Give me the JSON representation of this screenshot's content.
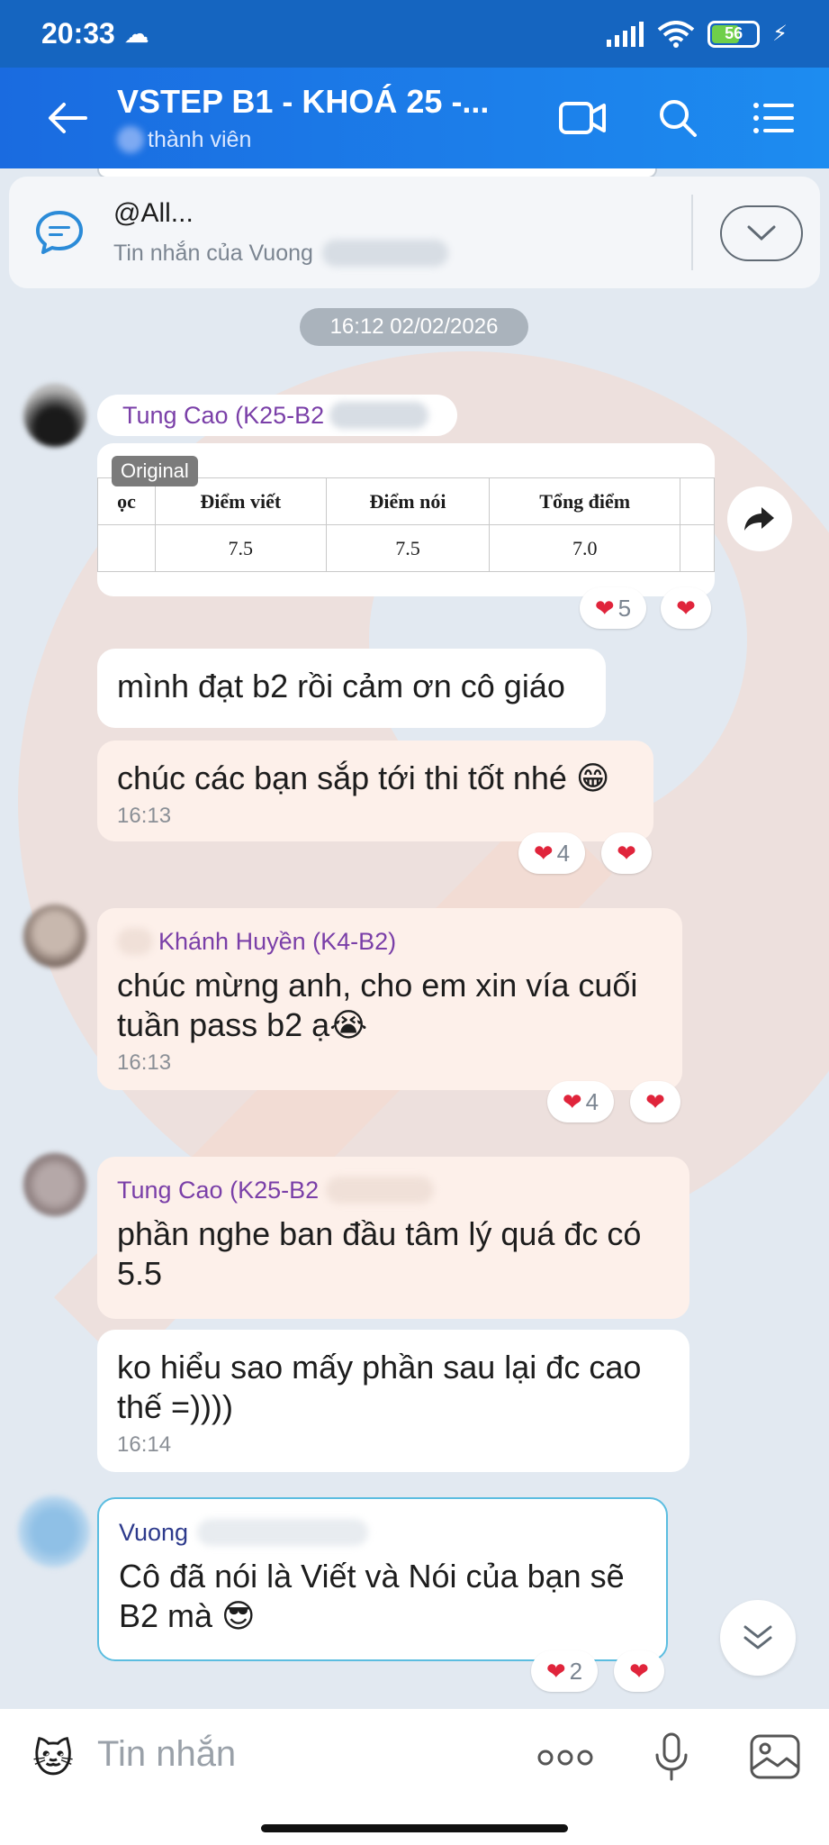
{
  "status_bar": {
    "time": "20:33",
    "battery": "56"
  },
  "header": {
    "title": "VSTEP B1 - KHOÁ 25 -...",
    "subtitle": "thành viên"
  },
  "pinned": {
    "title": "@All...",
    "subtitle": "Tin nhắn của Vuong"
  },
  "date_divider": "16:12 02/02/2026",
  "scorecard": {
    "badge": "Original",
    "headers": [
      "ọc",
      "Điểm viết",
      "Điểm nói",
      "Tổng điểm"
    ],
    "values": [
      "",
      "7.5",
      "7.5",
      "7.0"
    ]
  },
  "messages": [
    {
      "sender": "Tung Cao (K25-B2",
      "text": "mình đạt b2 rồi cảm ơn cô giáo"
    },
    {
      "text": "chúc các bạn sắp tới thi tốt nhé 😁",
      "time": "16:13"
    },
    {
      "sender": "Khánh Huyền (K4-B2)",
      "text": "chúc mừng anh, cho em xin vía cuối tuần pass b2 ạ😭",
      "time": "16:13"
    },
    {
      "sender": "Tung Cao (K25-B2",
      "text": "phần nghe ban đầu tâm lý quá đc có 5.5"
    },
    {
      "text": "ko hiểu sao mấy phần sau lại đc cao thế =))))",
      "time": "16:14"
    },
    {
      "sender": "Vuong",
      "text": "Cô đã nói là Viết và Nói của bạn sẽ B2 mà 😎"
    }
  ],
  "reactions": {
    "r1": "5",
    "r2": "4",
    "r3": "4",
    "r4": "2"
  },
  "input": {
    "placeholder": "Tin nhắn"
  },
  "colors": {
    "header": "#1a6be0",
    "accent": "#7a3fa8",
    "heart": "#e0243b"
  }
}
